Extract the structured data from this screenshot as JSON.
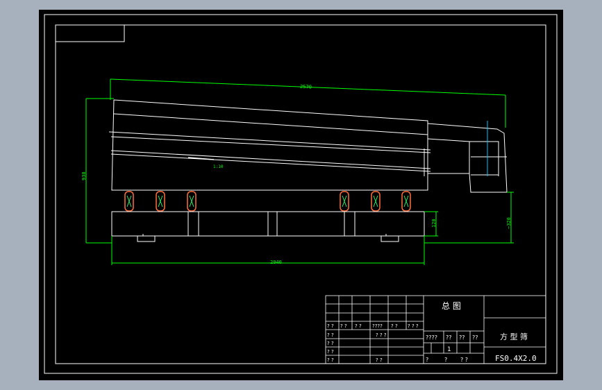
{
  "dimensions": {
    "top_length": "2570",
    "total_height": "930",
    "base_height": "120",
    "right_height": "~320",
    "base_length": "2040",
    "slope": "1:10"
  },
  "title_block": {
    "drawing_name": "总 图",
    "product_name": "方 型 筛",
    "drawing_number": "FS0.4X2.0",
    "sheet_count": "1",
    "scale_header": "????",
    "weight_header": "??",
    "qty_header": "??",
    "sheet_header": "??",
    "bottom_q1": "?",
    "bottom_q2": "?",
    "bottom_q3": "? ?",
    "rev_row": [
      "? ?",
      "? ?",
      "? ?",
      "????",
      "? ?",
      "? ? ?"
    ],
    "rows_left": [
      "? ?",
      "? ?",
      "? ?",
      "? ?"
    ],
    "row_mid": "? ? ?",
    "row_bottom": "? ?"
  },
  "colors": {
    "background": "#000000",
    "frame": "#ffffff",
    "dimension": "#00ff00",
    "spring_outer": "#ff6d3a",
    "spring_inner": "#2ef26a",
    "axis": "#00c8ff"
  }
}
